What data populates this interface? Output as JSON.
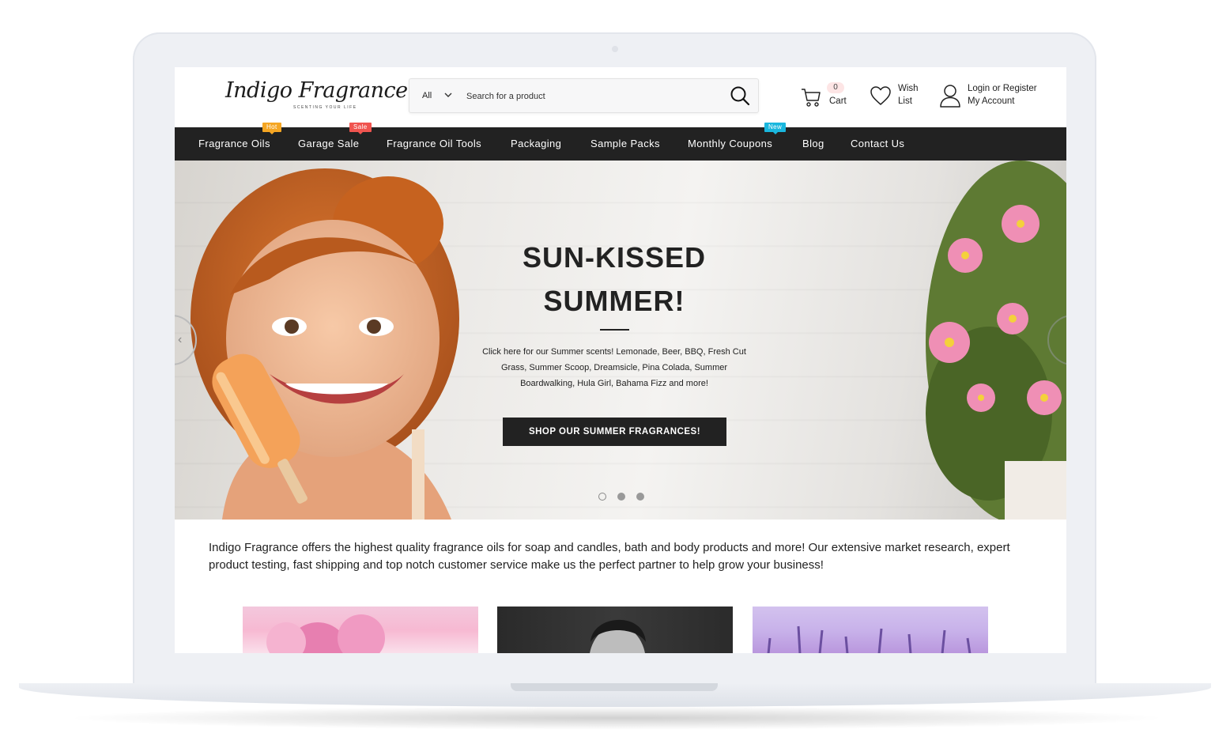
{
  "site": {
    "logo_text": "Indigo Fragrance",
    "logo_tagline": "SCENTING YOUR LIFE"
  },
  "search": {
    "category": "All",
    "placeholder": "Search for a product",
    "value": ""
  },
  "header": {
    "cart_count": "0",
    "cart_label": "Cart",
    "wishlist_line1": "Wish",
    "wishlist_line2": "List",
    "login_label": "Login or Register",
    "account_label": "My Account"
  },
  "nav": {
    "items": [
      {
        "label": "Fragrance Oils",
        "badge": "Hot",
        "badge_color": "#f5a623"
      },
      {
        "label": "Garage Sale",
        "badge": "Sale",
        "badge_color": "#f0544f"
      },
      {
        "label": "Fragrance Oil Tools"
      },
      {
        "label": "Packaging"
      },
      {
        "label": "Sample Packs"
      },
      {
        "label": "Monthly Coupons",
        "badge": "New",
        "badge_color": "#1ab7de"
      },
      {
        "label": "Blog"
      },
      {
        "label": "Contact Us"
      }
    ]
  },
  "hero": {
    "title_line1": "SUN-KISSED",
    "title_line2": "SUMMER!",
    "subtitle_line1": "Click here for our Summer scents! Lemonade, Beer, BBQ, Fresh Cut",
    "subtitle_line2": "Grass, Summer Scoop, Dreamsicle, Pina Colada, Summer",
    "subtitle_line3": "Boardwalking, Hula Girl, Bahama Fizz and more!",
    "cta": "SHOP OUR SUMMER FRAGRANCES!",
    "slide_count": 3,
    "active_slide": 1
  },
  "intro": {
    "text": "Indigo Fragrance offers the highest quality fragrance oils for soap and candles, bath and body products and more!  Our extensive market research, expert product testing, fast shipping and top notch customer service make us the perfect partner to help grow your business!"
  },
  "colors": {
    "nav_bg": "#222222",
    "cta_bg": "#222222",
    "hot": "#f5a623",
    "sale": "#f0544f",
    "new": "#1ab7de"
  }
}
